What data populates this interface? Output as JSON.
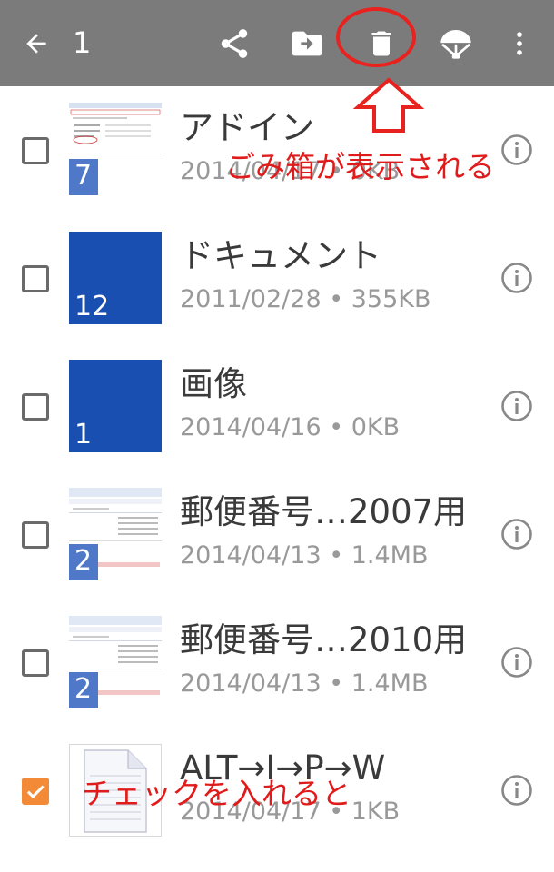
{
  "action_bar": {
    "selected_count": "1",
    "background": "#7b7b7b",
    "icons": [
      "arrow-back-icon",
      "share-icon",
      "move-to-folder-icon",
      "trash-icon",
      "offline-parachute-icon",
      "more-vert-icon"
    ]
  },
  "annotations": {
    "top_text": "ごみ箱が表示される",
    "bottom_text": "チェックを入れると",
    "color": "#e01b1b"
  },
  "files": [
    {
      "name": "アドイン",
      "meta": "2014/04/17 • 0KB",
      "count": "7",
      "checked": false,
      "thumb": "screenshot"
    },
    {
      "name": "ドキュメント",
      "meta": "2011/02/28 • 355KB",
      "count": "12",
      "checked": false,
      "thumb": "blue-folder"
    },
    {
      "name": "画像",
      "meta": "2014/04/16 • 0KB",
      "count": "1",
      "checked": false,
      "thumb": "blue-folder"
    },
    {
      "name": "郵便番号…2007用",
      "meta": "2014/04/13 • 1.4MB",
      "count": "2",
      "checked": false,
      "thumb": "screenshot"
    },
    {
      "name": "郵便番号…2010用",
      "meta": "2014/04/13 • 1.4MB",
      "count": "2",
      "checked": false,
      "thumb": "screenshot"
    },
    {
      "name": "ALT→I→P→W",
      "meta": "2014/04/17 • 1KB",
      "count": "",
      "checked": true,
      "thumb": "document"
    }
  ],
  "colors": {
    "checkbox_checked": "#f28a37",
    "folder_blue": "#1a4fb2",
    "meta_text": "#999999"
  }
}
